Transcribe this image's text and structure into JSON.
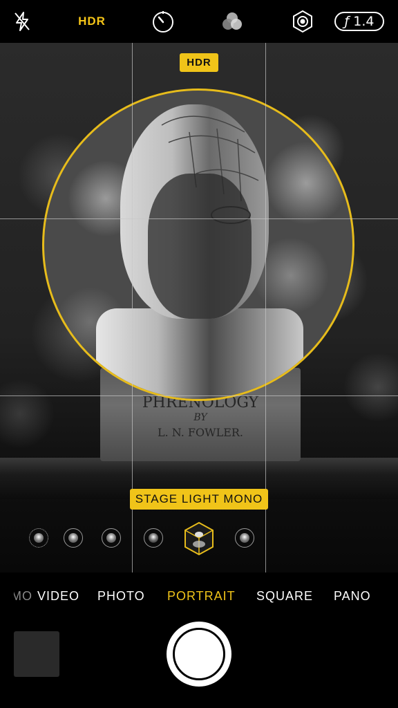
{
  "toolbar": {
    "flash_icon": "flash-off-icon",
    "hdr_label": "HDR",
    "timer_icon": "timer-icon",
    "filters_icon": "filters-icon",
    "live_icon": "live-photo-icon",
    "aperture_symbol": "ƒ",
    "aperture_value": "1.4"
  },
  "viewfinder": {
    "hdr_badge": "HDR",
    "base_line1": "PHRENOLOGY",
    "base_line2": "BY",
    "base_line3": "L. N.   FOWLER.",
    "lighting_label": "STAGE LIGHT MONO",
    "lighting_options": [
      "Natural Light",
      "Studio Light",
      "Contour Light",
      "Stage Light",
      "Stage Light Mono",
      "High-Key Light Mono"
    ],
    "selected_lighting": "Stage Light Mono",
    "accent_color": "#f0c419"
  },
  "modes": {
    "items": [
      "MO",
      "VIDEO",
      "PHOTO",
      "PORTRAIT",
      "SQUARE",
      "PANO"
    ],
    "active": "PORTRAIT"
  },
  "controls": {
    "shutter": "shutter-button",
    "thumbnail": "last-photo-thumbnail"
  }
}
